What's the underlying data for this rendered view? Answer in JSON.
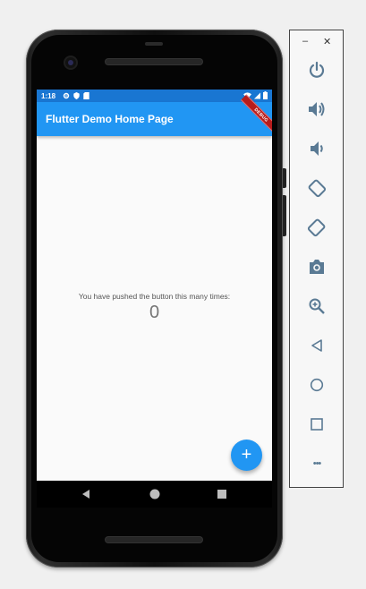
{
  "status_bar": {
    "time": "1:18"
  },
  "app_bar": {
    "title": "Flutter Demo Home Page",
    "debug_banner": "DEBUG"
  },
  "body": {
    "counter_label": "You have pushed the button this many times:",
    "counter_value": "0"
  },
  "fab": {
    "label": "+"
  },
  "emulator_toolbar": {
    "minimize": "–",
    "close": "✕",
    "more": "•••",
    "buttons": [
      "power-icon",
      "volume-up-icon",
      "volume-down-icon",
      "rotate-left-icon",
      "rotate-right-icon",
      "camera-icon",
      "zoom-icon",
      "back-icon",
      "home-icon",
      "overview-icon",
      "more-icon"
    ]
  },
  "colors": {
    "primary": "#2196f3",
    "status_bar": "#1976d2",
    "debug_banner": "#b71c1c"
  }
}
